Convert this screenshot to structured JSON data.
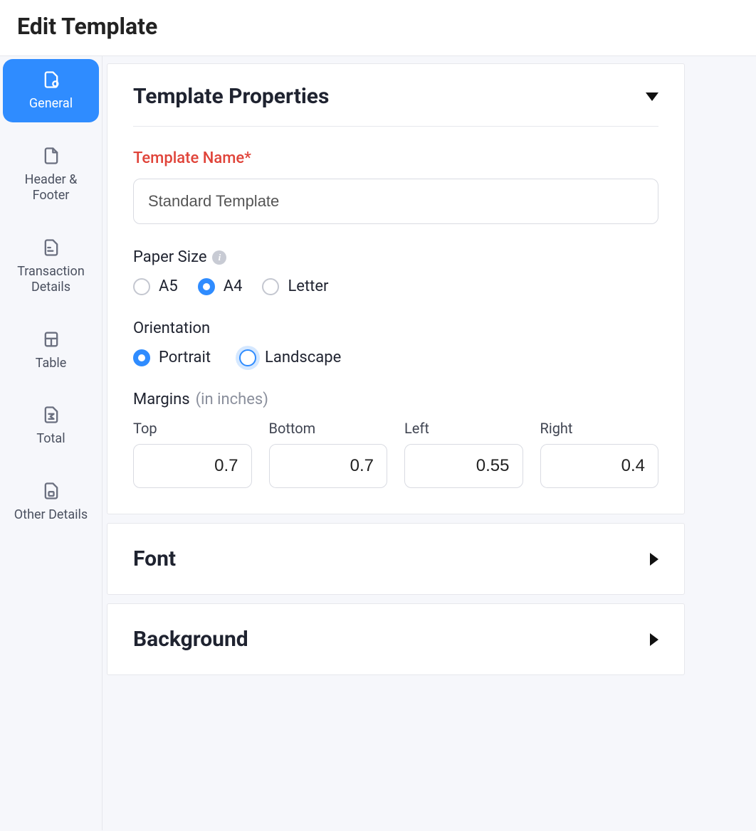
{
  "header": {
    "title": "Edit Template"
  },
  "sidebar": {
    "items": [
      {
        "label": "General",
        "active": true
      },
      {
        "label": "Header & Footer",
        "active": false
      },
      {
        "label": "Transaction Details",
        "active": false
      },
      {
        "label": "Table",
        "active": false
      },
      {
        "label": "Total",
        "active": false
      },
      {
        "label": "Other Details",
        "active": false
      }
    ]
  },
  "properties_panel": {
    "title": "Template Properties",
    "template_name": {
      "label": "Template Name*",
      "value": "Standard Template"
    },
    "paper_size": {
      "label": "Paper Size",
      "options": [
        "A5",
        "A4",
        "Letter"
      ],
      "selected": "A4"
    },
    "orientation": {
      "label": "Orientation",
      "options": [
        "Portrait",
        "Landscape"
      ],
      "selected": "Portrait",
      "focused": "Landscape"
    },
    "margins": {
      "label": "Margins",
      "unit_hint": "(in inches)",
      "top_label": "Top",
      "bottom_label": "Bottom",
      "left_label": "Left",
      "right_label": "Right",
      "top": "0.7",
      "bottom": "0.7",
      "left": "0.55",
      "right": "0.4"
    }
  },
  "font_panel": {
    "title": "Font"
  },
  "background_panel": {
    "title": "Background"
  }
}
